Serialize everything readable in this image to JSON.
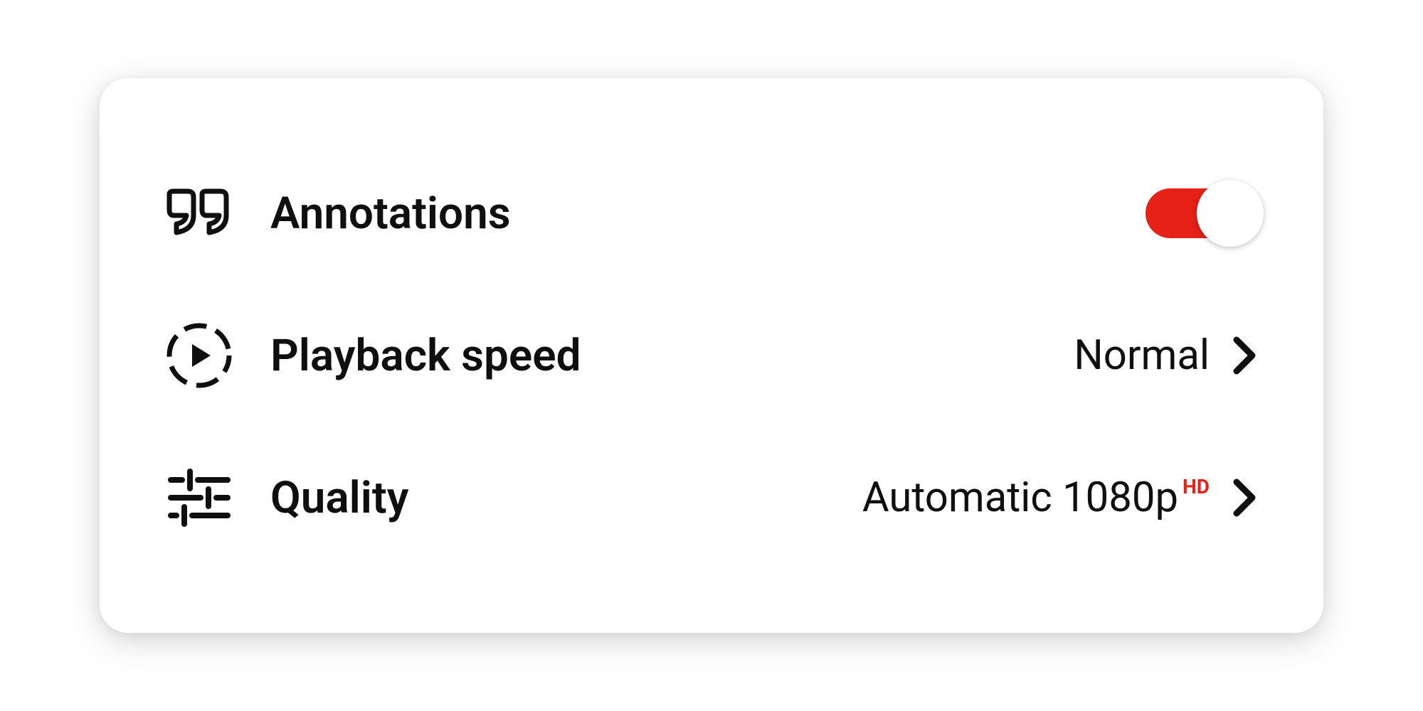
{
  "settings": {
    "annotations": {
      "label": "Annotations",
      "enabled": true
    },
    "playback_speed": {
      "label": "Playback speed",
      "value": "Normal"
    },
    "quality": {
      "label": "Quality",
      "value": "Automatic 1080p",
      "hd_badge": "HD"
    }
  },
  "colors": {
    "accent": "#e62117",
    "text": "#0f0f0f"
  }
}
